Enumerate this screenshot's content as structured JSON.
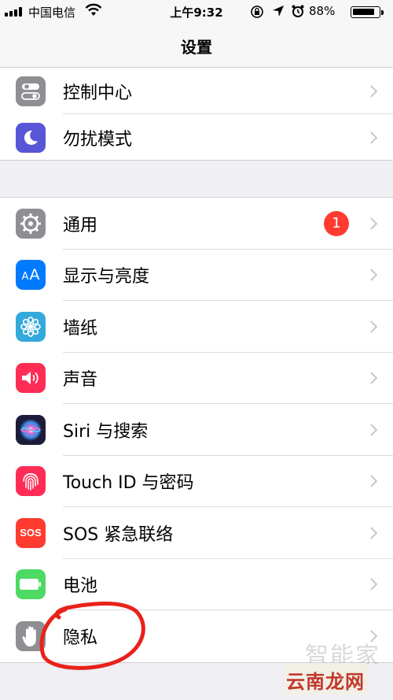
{
  "status_bar": {
    "carrier": "中国电信",
    "time": "上午9:32",
    "battery_percent": "88%",
    "battery_level": 0.88
  },
  "nav": {
    "title": "设置"
  },
  "group1": [
    {
      "label": "控制中心",
      "icon": "control-center-icon",
      "color": "#8e8e93"
    },
    {
      "label": "勿扰模式",
      "icon": "moon-icon",
      "color": "#5856d6"
    }
  ],
  "group2": [
    {
      "label": "通用",
      "icon": "gear-icon",
      "color": "#8e8e93",
      "badge": "1"
    },
    {
      "label": "显示与亮度",
      "icon": "text-size-icon",
      "color": "#007aff"
    },
    {
      "label": "墙纸",
      "icon": "flower-icon",
      "color": "#34aadc"
    },
    {
      "label": "声音",
      "icon": "speaker-icon",
      "color": "#ff2d55"
    },
    {
      "label": "Siri 与搜索",
      "icon": "siri-icon",
      "color": "#1c1c3a"
    },
    {
      "label": "Touch ID 与密码",
      "icon": "fingerprint-icon",
      "color": "#ff2d55"
    },
    {
      "label": "SOS 紧急联络",
      "icon": "sos-icon",
      "color": "#ff3b30",
      "icon_text": "SOS"
    },
    {
      "label": "电池",
      "icon": "battery-icon",
      "color": "#4cd964"
    },
    {
      "label": "隐私",
      "icon": "hand-icon",
      "color": "#8e8e93"
    }
  ],
  "text_size_glyph": "AA",
  "watermark": {
    "faint": "智能家",
    "main": "云南龙网"
  }
}
